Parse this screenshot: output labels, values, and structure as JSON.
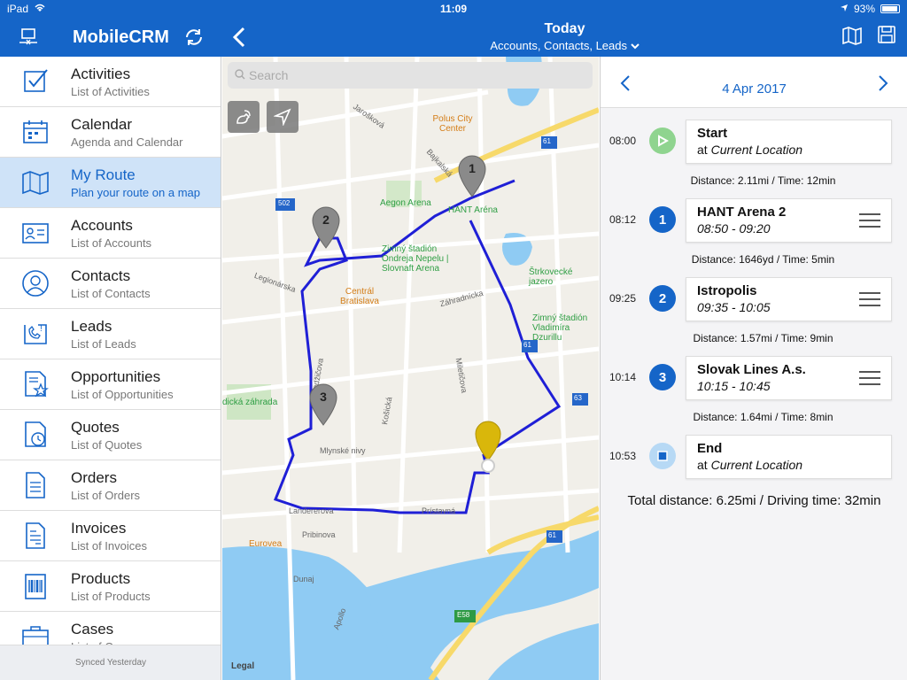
{
  "status": {
    "device": "iPad",
    "time": "11:09",
    "battery": "93%"
  },
  "nav": {
    "app_title": "MobileCRM",
    "title": "Today",
    "subtitle": "Accounts, Contacts, Leads"
  },
  "sidebar": {
    "items": [
      {
        "label": "Activities",
        "sub": "List of Activities",
        "icon": "activities-checklist-icon"
      },
      {
        "label": "Calendar",
        "sub": "Agenda and Calendar",
        "icon": "calendar-icon"
      },
      {
        "label": "My Route",
        "sub": "Plan your route on a map",
        "icon": "route-map-icon"
      },
      {
        "label": "Accounts",
        "sub": "List of Accounts",
        "icon": "accounts-card-icon"
      },
      {
        "label": "Contacts",
        "sub": "List of Contacts",
        "icon": "contacts-person-icon"
      },
      {
        "label": "Leads",
        "sub": "List of Leads",
        "icon": "leads-phone-icon"
      },
      {
        "label": "Opportunities",
        "sub": "List of Opportunities",
        "icon": "opportunities-star-icon"
      },
      {
        "label": "Quotes",
        "sub": "List of Quotes",
        "icon": "quotes-clock-icon"
      },
      {
        "label": "Orders",
        "sub": "List of Orders",
        "icon": "orders-document-icon"
      },
      {
        "label": "Invoices",
        "sub": "List of Invoices",
        "icon": "invoices-document-icon"
      },
      {
        "label": "Products",
        "sub": "List of Products",
        "icon": "products-barcode-icon"
      },
      {
        "label": "Cases",
        "sub": "List of Cases",
        "icon": "cases-briefcase-icon"
      }
    ],
    "footer": "Synced Yesterday"
  },
  "map": {
    "search_placeholder": "Search",
    "legal": "Legal",
    "pins": [
      "1",
      "2",
      "3"
    ],
    "labels": {
      "polus": "Polus City Center",
      "aegon": "Aegon Arena",
      "hant": "HANT Aréna",
      "zimny": "Zimný štadión Ondreja Nepelu | Slovnaft Arena",
      "central": "Centrál Bratislava",
      "strkovecke": "Štrkovecké jazero",
      "zimny2": "Zimný štadión Vladimíra Dzurillu",
      "eurovea": "Eurovea",
      "botanicka": "dická záhrada",
      "jaroskova": "Jarošková",
      "bajkalska": "Bajkalská",
      "zahradnicka": "Záhradnícka",
      "legionarska": "Legionárska",
      "karadzicova": "Karadžičova",
      "kosicka": "Košická",
      "miletičova": "Miletičova",
      "mlynske": "Mlynské nivy",
      "landererova": "Landererova",
      "pristavna": "Prístavná",
      "dunaj": "Dunaj",
      "pribinova": "Pribinova",
      "apollo": "Apollo",
      "r61": "61",
      "r63": "63",
      "r502": "502",
      "e58": "E58"
    }
  },
  "route": {
    "date": "4 Apr 2017",
    "stops": [
      {
        "time": "08:00",
        "marker": "",
        "title": "Start",
        "sub_prefix": "at ",
        "sub": "Current Location"
      },
      {
        "time": "08:12",
        "marker": "1",
        "title": "HANT Arena 2",
        "sub_prefix": "",
        "sub": "08:50 - 09:20"
      },
      {
        "time": "09:25",
        "marker": "2",
        "title": "Istropolis",
        "sub_prefix": "",
        "sub": "09:35 - 10:05"
      },
      {
        "time": "10:14",
        "marker": "3",
        "title": "Slovak Lines A.s.",
        "sub_prefix": "",
        "sub": "10:15 - 10:45"
      },
      {
        "time": "10:53",
        "marker": "",
        "title": "End",
        "sub_prefix": "at ",
        "sub": "Current Location"
      }
    ],
    "distances": [
      "Distance: 2.11mi / Time: 12min",
      "Distance: 1646yd / Time: 5min",
      "Distance: 1.57mi / Time: 9min",
      "Distance: 1.64mi / Time: 8min"
    ],
    "total": "Total distance: 6.25mi / Driving time: 32min"
  },
  "colors": {
    "brand": "#1565c8",
    "route": "#1f1fd6",
    "start_marker": "#8fd48f",
    "stop_marker": "#1565c8",
    "end_marker": "#b7d9f5",
    "highlight": "#cfe3f8"
  }
}
